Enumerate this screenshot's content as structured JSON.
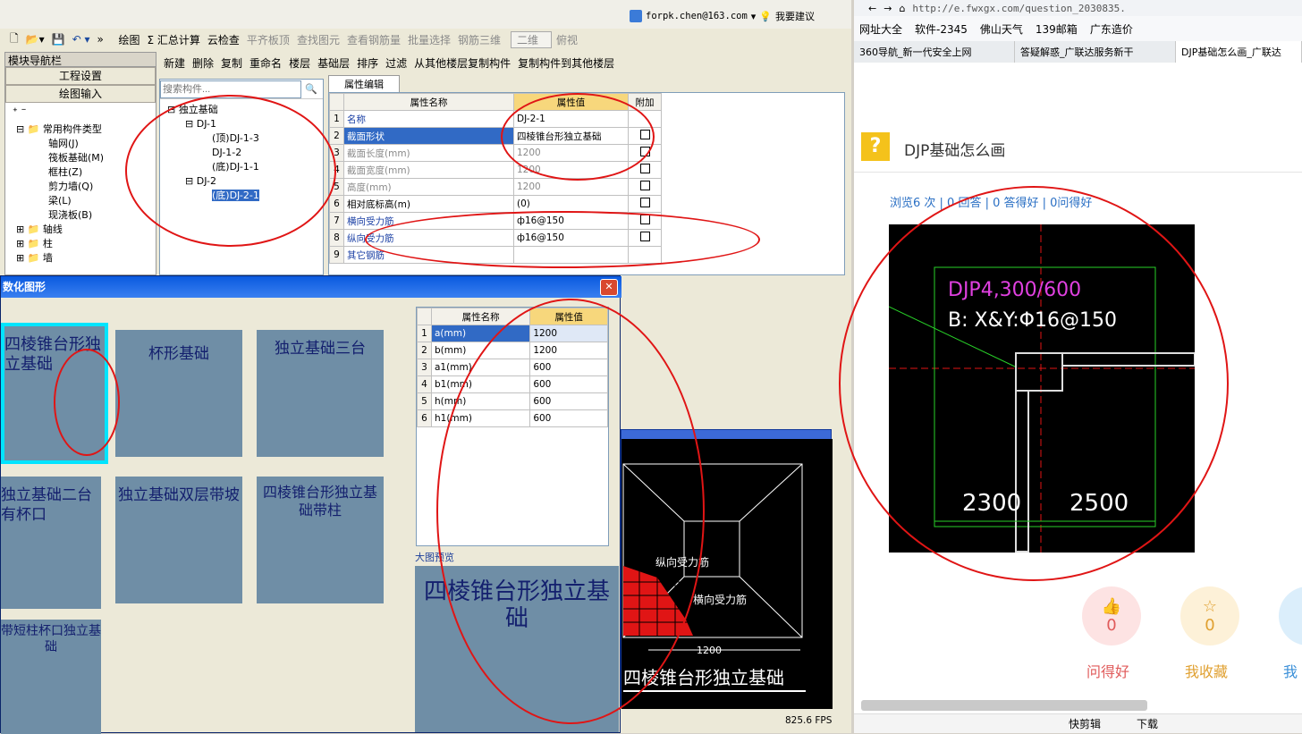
{
  "account": {
    "email": "forpk.chen@163.com",
    "suggest": "我要建议"
  },
  "toolbar1": {
    "items": [
      "绘图",
      "Σ 汇总计算",
      "云检查",
      "平齐板顶",
      "查找图元",
      "查看钢筋量",
      "批量选择",
      "钢筋三维",
      "二维",
      "俯视"
    ]
  },
  "toolbar2": {
    "items": [
      "新建",
      "删除",
      "复制",
      "重命名",
      "楼层",
      "基础层",
      "排序",
      "过滤",
      "从其他楼层复制构件",
      "复制构件到其他楼层"
    ]
  },
  "nav": {
    "title": "模块导航栏",
    "btn_project": "工程设置",
    "btn_draw": "绘图输入",
    "tree": [
      "常用构件类型",
      "轴网(J)",
      "筏板基础(M)",
      "框柱(Z)",
      "剪力墙(Q)",
      "梁(L)",
      "现浇板(B)",
      "轴线",
      "柱",
      "墙"
    ]
  },
  "search": {
    "placeholder": "搜索构件..."
  },
  "comp_tree": [
    "独立基础",
    "DJ-1",
    "(顶)DJ-1-3",
    "DJ-1-2",
    "(底)DJ-1-1",
    "DJ-2",
    "(底)DJ-2-1"
  ],
  "prop_tab": "属性编辑",
  "prop_table": {
    "headers": [
      "属性名称",
      "属性值",
      "附加"
    ],
    "rows": [
      [
        "1",
        "名称",
        "DJ-2-1"
      ],
      [
        "2",
        "截面形状",
        "四棱锥台形独立基础"
      ],
      [
        "3",
        "截面长度(mm)",
        "1200"
      ],
      [
        "4",
        "截面宽度(mm)",
        "1200"
      ],
      [
        "5",
        "高度(mm)",
        "1200"
      ],
      [
        "6",
        "相对底标高(m)",
        "(0)"
      ],
      [
        "7",
        "横向受力筋",
        "ф16@150"
      ],
      [
        "8",
        "纵向受力筋",
        "ф16@150"
      ],
      [
        "9",
        "其它钢筋",
        ""
      ]
    ]
  },
  "dialog": {
    "title": "数化图形",
    "cards": [
      "四棱锥台形独立基础",
      "杯形基础",
      "独立基础三台",
      "独立基础二台有杯口",
      "独立基础双层带坡",
      "四棱锥台形独立基础带柱",
      "带短柱杯口独立基础"
    ],
    "param_headers": [
      "属性名称",
      "属性值"
    ],
    "params": [
      [
        "1",
        "a(mm)",
        "1200"
      ],
      [
        "2",
        "b(mm)",
        "1200"
      ],
      [
        "3",
        "a1(mm)",
        "600"
      ],
      [
        "4",
        "b1(mm)",
        "600"
      ],
      [
        "5",
        "h(mm)",
        "600"
      ],
      [
        "6",
        "h1(mm)",
        "600"
      ]
    ],
    "preview_label": "大图预览",
    "preview_title": "四棱锥台形独立基础",
    "fps": "825.6 FPS"
  },
  "cad_preview": {
    "lbl1": "纵向受力筋",
    "lbl2": "横向受力筋",
    "dim": "1200",
    "title": "四棱锥台形独立基础"
  },
  "browser": {
    "url": "http://e.fwxgx.com/question_2030835.",
    "bookmarks": [
      "网址大全",
      "软件-2345",
      "佛山天气",
      "139邮箱",
      "广东造价"
    ],
    "tabs": [
      "360导航_新一代安全上网",
      "答疑解惑_广联达服务新干",
      "DJP基础怎么画_广联达"
    ],
    "question": "DJP基础怎么画",
    "stats": "浏览6 次 | 0 回答 | 0 答得好 | 0问得好",
    "cad_text1": "DJP4,300/600",
    "cad_text2": "B: X&Y:Φ16@150",
    "dim1": "2300",
    "dim2": "2500",
    "actions": [
      {
        "label": "问得好",
        "count": "0"
      },
      {
        "label": "我收藏",
        "count": "0"
      },
      {
        "label": "我",
        "count": ""
      }
    ],
    "status": [
      "快剪辑",
      "下载"
    ]
  },
  "colors": {
    "accent_red": "#e01515",
    "title_blue": "#0a5adf",
    "prop_hl": "#f7d77c"
  }
}
